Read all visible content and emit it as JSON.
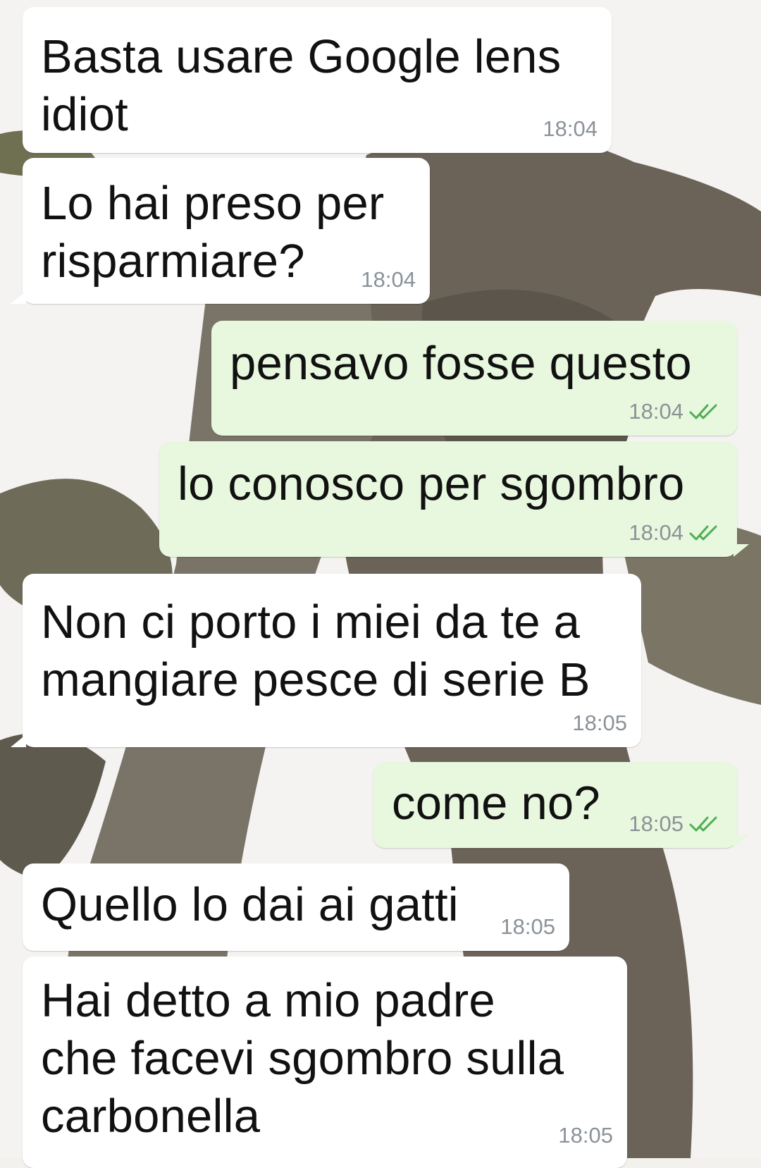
{
  "colors": {
    "incoming_bubble": "#ffffff",
    "outgoing_bubble": "#e8f8de",
    "time_text": "#8b9298",
    "read_ticks": "#4fae52"
  },
  "messages": [
    {
      "direction": "in",
      "text": "Basta usare Google lens\nidiot",
      "time": "18:04"
    },
    {
      "direction": "in",
      "text": "Lo hai preso per\nrisparmiare?",
      "time": "18:04"
    },
    {
      "direction": "out",
      "text": "pensavo fosse questo",
      "time": "18:04",
      "status": "read-ticks-icon"
    },
    {
      "direction": "out",
      "text": "lo conosco per sgombro",
      "time": "18:04",
      "status": "read-ticks-icon"
    },
    {
      "direction": "in",
      "text": "Non ci porto i miei da te a\nmangiare pesce di serie B",
      "time": "18:05"
    },
    {
      "direction": "out",
      "text": "come no?",
      "time": "18:05",
      "status": "read-ticks-icon"
    },
    {
      "direction": "in",
      "text": "Quello lo dai ai gatti",
      "time": "18:05"
    },
    {
      "direction": "in",
      "text": "Hai detto a mio padre\nche facevi sgombro sulla\ncarbonella",
      "time": "18:05"
    }
  ]
}
